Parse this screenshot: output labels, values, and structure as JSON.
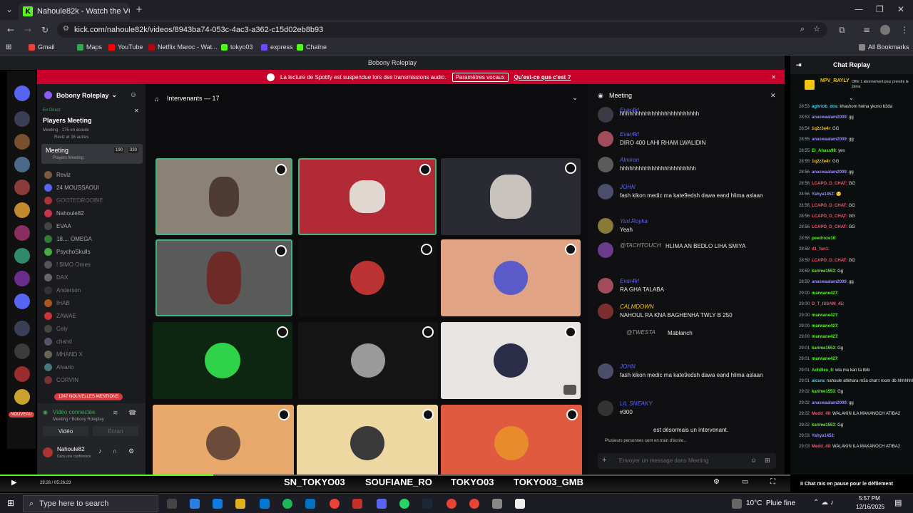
{
  "browser": {
    "tab_title": "Nahoule82k - Watch the VOD o",
    "new_tab": "+",
    "url": "kick.com/nahoule82k/videos/8943ba74-053c-4ac3-a362-c15d02eb8b93",
    "bookmarks": [
      "Gmail",
      "Maps",
      "YouTube",
      "Netflix Maroc - Wat...",
      "tokyo03",
      "express",
      "Chaîne"
    ],
    "all_bookmarks": "All Bookmarks"
  },
  "discord": {
    "window_title": "Bobony Roleplay",
    "spotify_notice": "La lecture de Spotify est suspendue lors des transmissions audio.",
    "spotify_button": "Paramètres vocaux",
    "spotify_link": "Qu'est-ce que c'est ?",
    "server_name": "Bobony Roleplay",
    "live_label": "En Direct",
    "event_name": "Players Meeting",
    "event_sub": "Meeting · 175 en écoute",
    "event_sub2": "Reviz et 16 autres",
    "channel_name": "Meeting",
    "channel_count": "190",
    "channel_max": "330",
    "channel_sub": "Players Meeting",
    "members": [
      "Reviz",
      "24 MOUSSAOUI",
      "GOOTEDROOBIE",
      "Nahoule82",
      "EVAA",
      "18.... OMEGA",
      "PsychoSkulls",
      "! $IMO Ornes",
      "DAX",
      "Anderson",
      "IHAB",
      "ZAWAE",
      "Cely",
      "chahd",
      "MHAND X",
      "Alvario",
      "CORVIN"
    ],
    "mentions_badge": "1247 NOUVELLES MENTIONS",
    "new_badge": "NOUVEAU",
    "voice_status": "Vidéo connectée",
    "voice_sub": "Meeting / Bobony Roleplay",
    "video_btn": "Vidéo",
    "screen_btn": "Écran",
    "user_name": "Nahoule82",
    "user_status": "Dans une conférence",
    "speakers_label": "Intervenants — 17",
    "meeting_title": "Meeting",
    "messages": [
      {
        "name": "Evar4k!",
        "time": "23:24",
        "text": "hhhhhhhhhhhhhhhhhhhhhhhhh"
      },
      {
        "name": "Evar4k!",
        "time": "23:24",
        "text": "DIRO 400 LAHI RHAM LWALIDIN"
      },
      {
        "name": "Almiron",
        "time": "23:24",
        "text": "hhhhhhhhhhhhhhhhhhhhhhhh"
      },
      {
        "name": "JOHN",
        "time": "23:24",
        "text": "fash kikon medic ma kate9edsh dawa eand hlima aslaan"
      },
      {
        "name": "Yuri.Royka",
        "time": "23:24",
        "text": "Yeah"
      },
      {
        "name": "@TACHTOUCH",
        "time": "",
        "text": "HLIMA AN BEDLO LIHA SMIYA"
      },
      {
        "name": "Evar4k!",
        "time": "23:24",
        "text": "RA GHA TALABA"
      },
      {
        "name": "CALMDOWN",
        "time": "23:24",
        "text": "NAHOUL RA KNA BAGHENHA TWLY B 250"
      },
      {
        "name": "@TWESTA",
        "time": "",
        "text": "Mablanch"
      },
      {
        "name": "JOHN",
        "time": "23:24",
        "text": "fash kikon medic ma kate9edsh dawa eand hlima aslaan"
      },
      {
        "name": "LIL SNEAKY",
        "time": "23:24",
        "text": "#300"
      },
      {
        "name": "",
        "time": "23:24",
        "text": "est désormais un intervenant."
      }
    ],
    "typing": "Plusieurs personnes sont en train d'écrire...",
    "chat_placeholder": "Envoyer un message dans Meeting"
  },
  "kick_chat": {
    "header": "Chat Replay",
    "pinned_user": "NPV_RAYLY",
    "pinned_text": "Offrir 1 abonnement pour prendre la 2ème",
    "lines": [
      {
        "t": "28:53",
        "u": "aghriob_dos",
        "m": "khashom homa ykono b3da"
      },
      {
        "t": "28:53",
        "u": "anaswaalam2009",
        "m": "gg"
      },
      {
        "t": "28:54",
        "u": "1q2z3e4r",
        "m": "GG"
      },
      {
        "t": "28:55",
        "u": "anaswaalam2009",
        "m": "gg"
      },
      {
        "t": "28:55",
        "u": "El_Anass98",
        "m": "yes"
      },
      {
        "t": "28:55",
        "u": "1q2z3e4r",
        "m": "GG"
      },
      {
        "t": "28:56",
        "u": "anaswaalam2009",
        "m": "gg"
      },
      {
        "t": "28:56",
        "u": "LCAPO_D_CHAT",
        "m": "GG"
      },
      {
        "t": "28:56",
        "u": "Yahya1452",
        "m": "🙂"
      },
      {
        "t": "28:56",
        "u": "LCAPO_D_CHAT",
        "m": "GG"
      },
      {
        "t": "28:56",
        "u": "LCAPO_D_CHAT",
        "m": "GG"
      },
      {
        "t": "28:56",
        "u": "LCAPO_D_CHAT",
        "m": "GG"
      },
      {
        "t": "28:58",
        "u": "peedroze10",
        "m": ""
      },
      {
        "t": "28:58",
        "u": "d1_fun1",
        "m": ""
      },
      {
        "t": "28:59",
        "u": "LCAPO_D_CHAT",
        "m": "GG"
      },
      {
        "t": "28:59",
        "u": "karime1553",
        "m": "Gg"
      },
      {
        "t": "28:59",
        "u": "anaswaalam2009",
        "m": "gg"
      },
      {
        "t": "29:00",
        "u": "marwane427",
        "m": ""
      },
      {
        "t": "29:00",
        "u": "D_T_ISSAM_45",
        "m": ""
      },
      {
        "t": "29:00",
        "u": "marwane427",
        "m": ""
      },
      {
        "t": "29:00",
        "u": "marwane427",
        "m": ""
      },
      {
        "t": "29:00",
        "u": "marwane427",
        "m": ""
      },
      {
        "t": "29:01",
        "u": "karime1553",
        "m": "Gg"
      },
      {
        "t": "29:01",
        "u": "marwane427",
        "m": ""
      },
      {
        "t": "29:01",
        "u": "Achilles_6",
        "m": "wla ma kan ta tbib"
      },
      {
        "t": "29:01",
        "u": "aicura",
        "m": "nahoule altkhara m3a chat t room db hhhhhhhhh"
      },
      {
        "t": "29:02",
        "u": "karime1553",
        "m": "Gg"
      },
      {
        "t": "29:02",
        "u": "anaswaalam2009",
        "m": "gg"
      },
      {
        "t": "29:02",
        "u": "Medd_49",
        "m": "WALAKIN ILA MAKANOCH ATIBA2"
      },
      {
        "t": "29:02",
        "u": "karime1553",
        "m": "Gg"
      },
      {
        "t": "29:03",
        "u": "Yahya1452",
        "m": ""
      },
      {
        "t": "29:03",
        "u": "Medd_49",
        "m": "WALAKIN ILA MAKANOCH ATIBA2"
      }
    ],
    "pause_msg": "Chat mis en pause pour le défilement"
  },
  "overlay": {
    "social1": "SN_TOKYO03",
    "social2": "SOUFIANE_RO",
    "social3": "TOKYO03",
    "social4": "TOKYO03_GMB",
    "time": "29:28 / 05:26:23"
  },
  "taskbar": {
    "search": "Type here to search",
    "weather": "10°C  Pluie fine",
    "clock": "5:57 PM",
    "date": "12/16/2025"
  }
}
